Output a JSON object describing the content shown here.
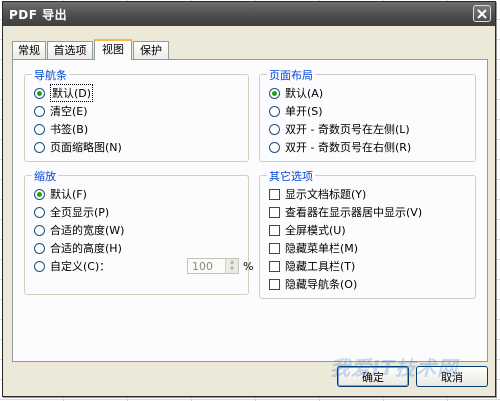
{
  "window": {
    "title": "PDF 导出",
    "close_glyph": "✕"
  },
  "tabs": [
    {
      "label": "常规",
      "active": false
    },
    {
      "label": "首选项",
      "active": false
    },
    {
      "label": "视图",
      "active": true
    },
    {
      "label": "保护",
      "active": false
    }
  ],
  "nav_group": {
    "title": "导航条",
    "options": [
      {
        "label": "默认(D)",
        "selected": true
      },
      {
        "label": "清空(E)",
        "selected": false
      },
      {
        "label": "书签(B)",
        "selected": false
      },
      {
        "label": "页面缩略图(N)",
        "selected": false
      }
    ]
  },
  "layout_group": {
    "title": "页面布局",
    "options": [
      {
        "label": "默认(A)",
        "selected": true
      },
      {
        "label": "单开(S)",
        "selected": false
      },
      {
        "label": "双开 - 奇数页号在左侧(L)",
        "selected": false
      },
      {
        "label": "双开 - 奇数页号在右侧(R)",
        "selected": false
      }
    ]
  },
  "zoom_group": {
    "title": "缩放",
    "options": [
      {
        "label": "默认(F)",
        "selected": true
      },
      {
        "label": "全页显示(P)",
        "selected": false
      },
      {
        "label": "合适的宽度(W)",
        "selected": false
      },
      {
        "label": "合适的高度(H)",
        "selected": false
      },
      {
        "label": "自定义(C)：",
        "selected": false
      }
    ],
    "custom_value": "100",
    "custom_unit": "%"
  },
  "other_group": {
    "title": "其它选项",
    "options": [
      {
        "label": "显示文档标题(Y)",
        "checked": false
      },
      {
        "label": "查看器在显示器居中显示(V)",
        "checked": false
      },
      {
        "label": "全屏模式(U)",
        "checked": false
      },
      {
        "label": "隐藏菜单栏(M)",
        "checked": false
      },
      {
        "label": "隐藏工具栏(T)",
        "checked": false
      },
      {
        "label": "隐藏导航条(O)",
        "checked": false
      }
    ]
  },
  "buttons": {
    "ok": "确定",
    "cancel": "取消"
  },
  "watermark": "我爱IT技术网"
}
